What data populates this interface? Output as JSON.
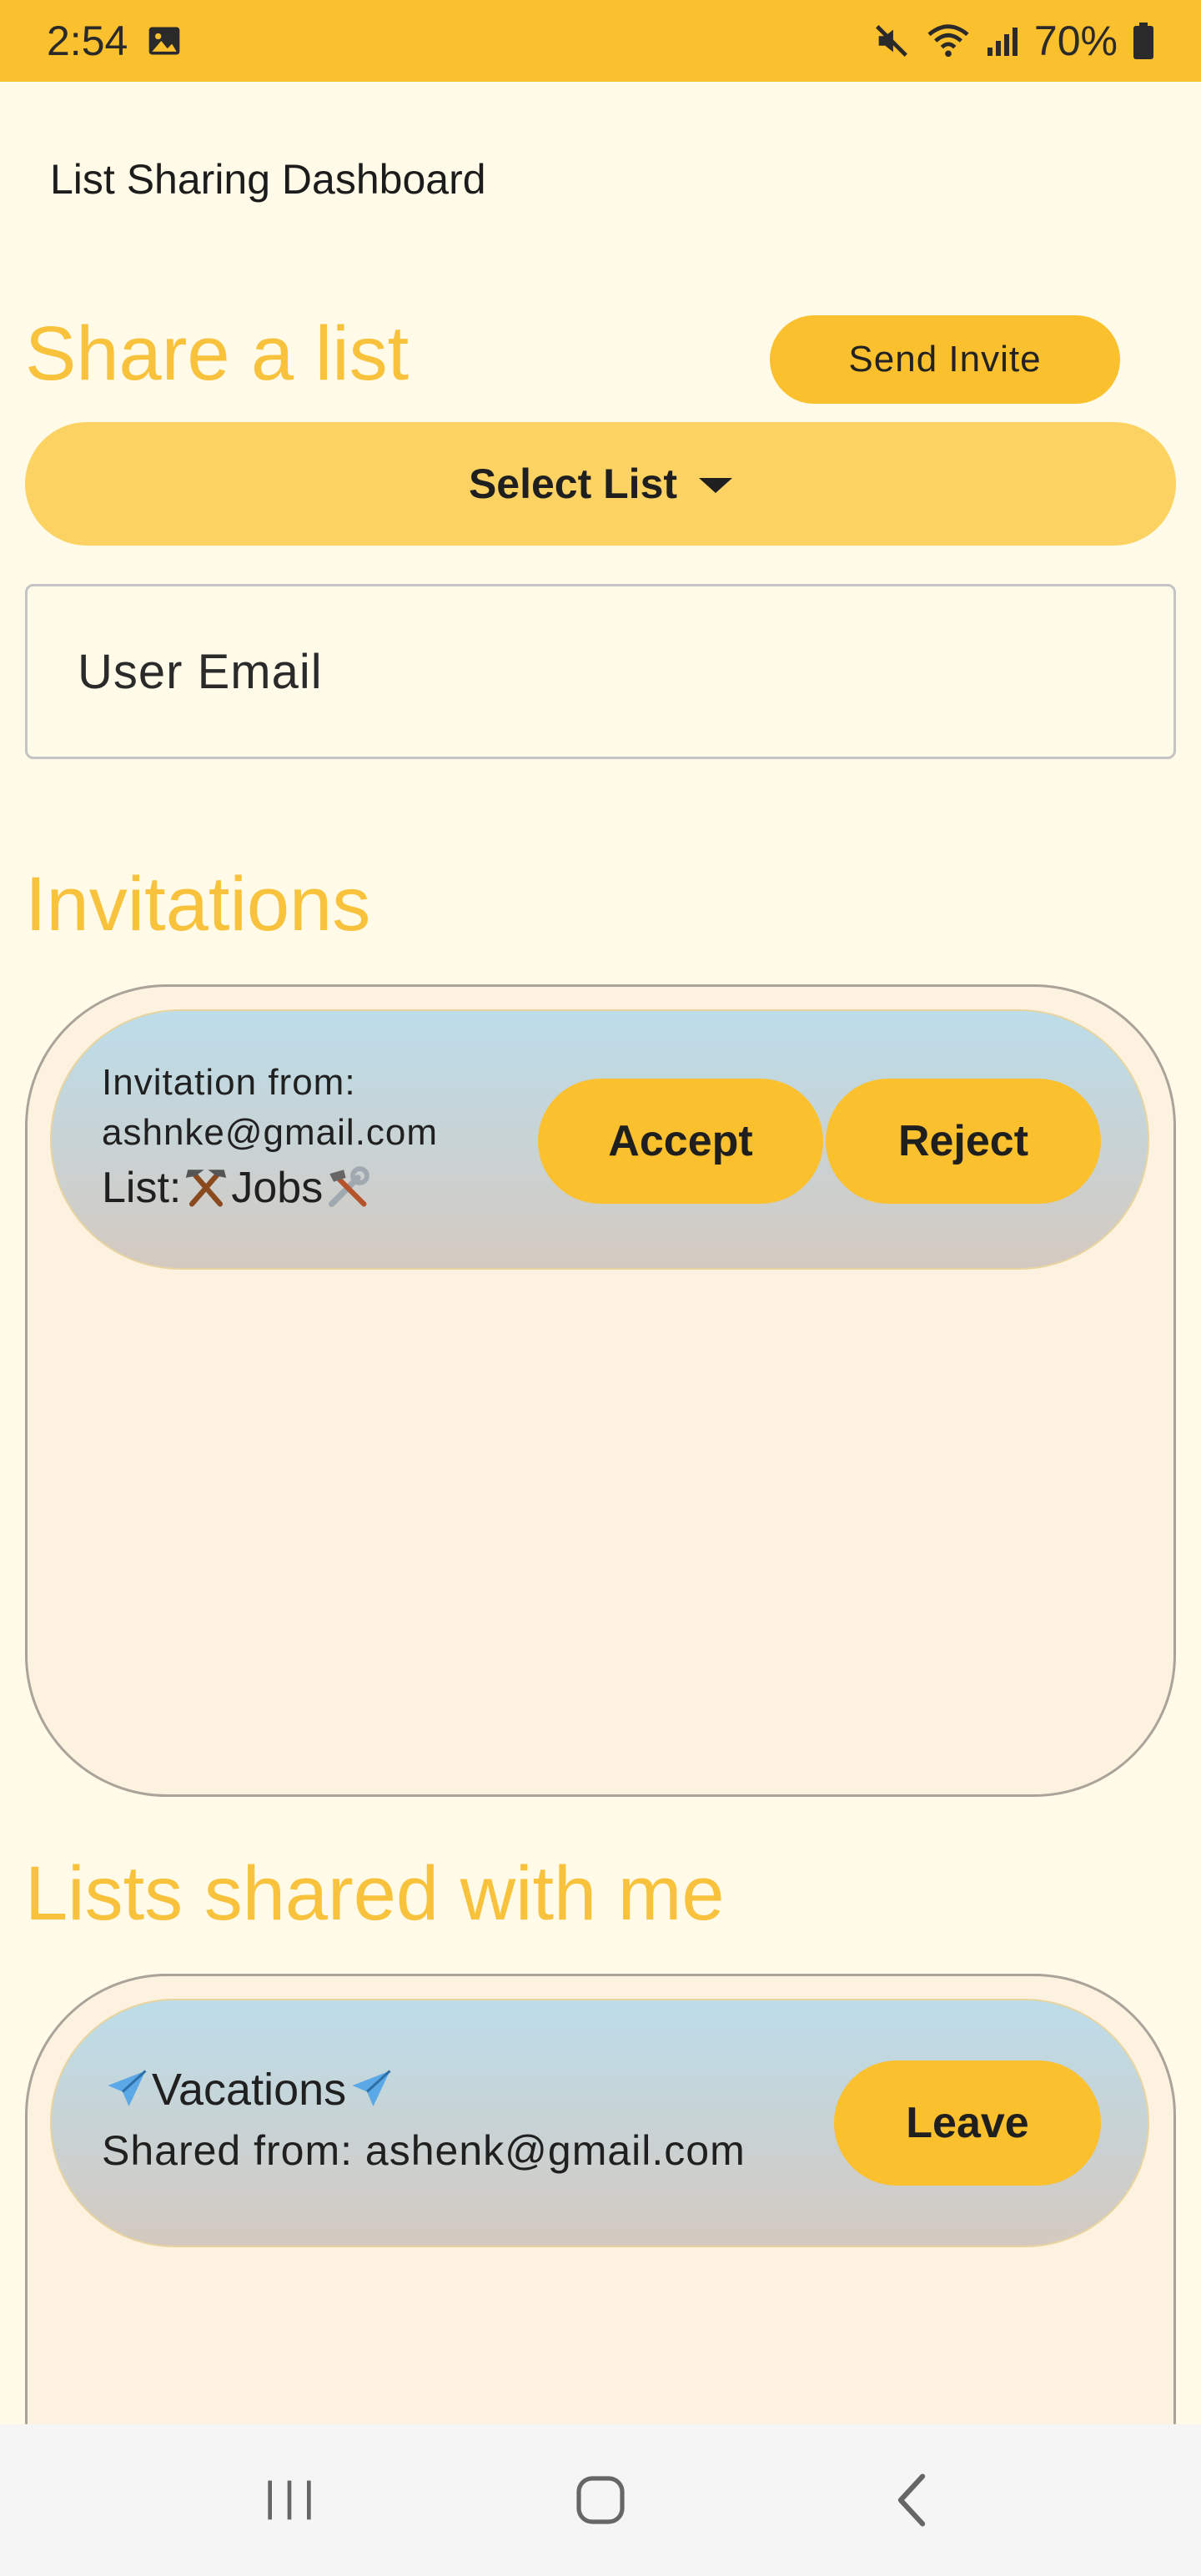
{
  "status_bar": {
    "time": "2:54",
    "battery": "70%",
    "icons": [
      "gallery-icon",
      "mute-icon",
      "wifi-icon",
      "signal-icon",
      "battery-icon"
    ]
  },
  "app_bar": {
    "title": "List Sharing Dashboard"
  },
  "share_section": {
    "heading": "Share a list",
    "send_invite_label": "Send Invite",
    "select_list_label": "Select List",
    "email_placeholder": "User Email"
  },
  "invitations_section": {
    "heading": "Invitations",
    "items": [
      {
        "from_label": "Invitation from:",
        "from_email": "ashnke@gmail.com",
        "list_prefix": "List: ",
        "list_name": "Jobs",
        "list_icon": "hammer-pick-icon",
        "list_icon_trailing": "hammer-wrench-icon",
        "accept_label": "Accept",
        "reject_label": "Reject"
      }
    ]
  },
  "shared_section": {
    "heading": "Lists shared with me",
    "items": [
      {
        "name": "Vacations",
        "icon": "airplane-icon",
        "shared_from_label": "Shared from: ashenk@gmail.com",
        "leave_label": "Leave"
      }
    ]
  },
  "colors": {
    "accent": "#FBC02D",
    "heading": "#F9C23C",
    "background": "#FFFBE8",
    "panel": "#FDF2DF"
  }
}
